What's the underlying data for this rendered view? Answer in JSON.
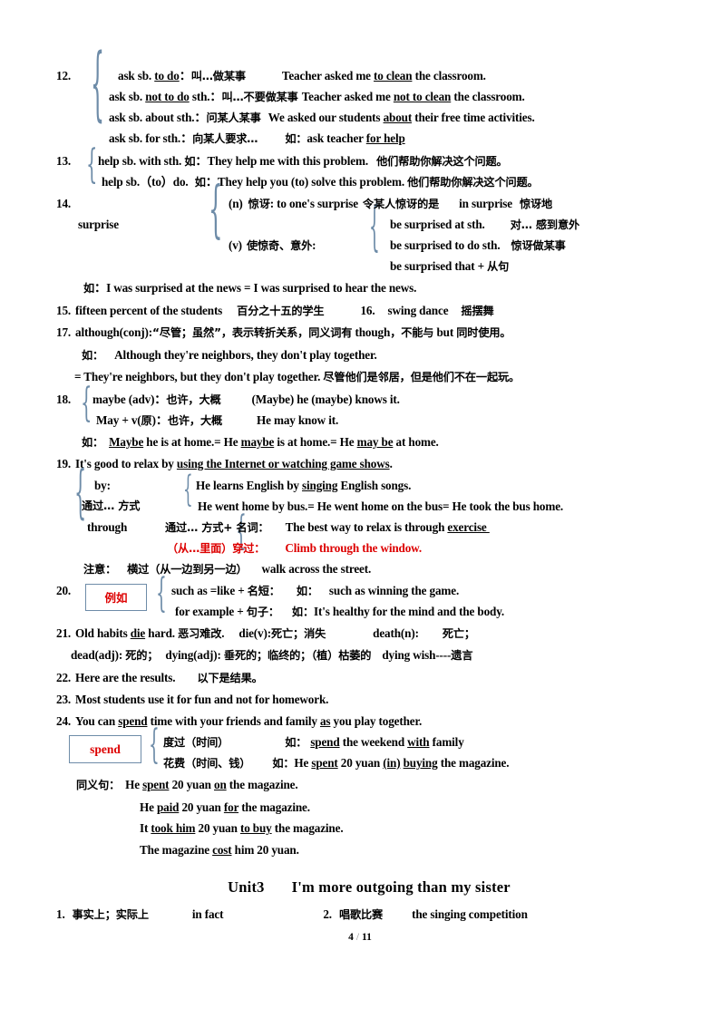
{
  "document": {
    "page_label": "4",
    "page_total": "11",
    "page_separator": "/"
  },
  "colors": {
    "brace": "#6E8CA8",
    "accent_red": "#DD0000",
    "text": "#000000",
    "box_border": "#6E8CA8"
  },
  "entries": [
    {
      "number": "12.",
      "lines": [
        "ask sb. to do：叫…做某事",
        "ask sb. not to do sth.：叫…不要做某事",
        "ask sb. about sth.：问某人某事",
        "ask sb. for sth.：向某人要求…"
      ],
      "examples": [
        "Teacher asked me to clean the classroom.",
        "Teacher asked me not to clean the classroom.",
        "We asked our students about their free time activities.",
        "如：ask teacher for help"
      ]
    },
    {
      "number": "13.",
      "lines": [
        "help sb. with sth.  如：They help me with this problem.  他们帮助你解决这个问题。",
        "help sb.（to）do.   如：They help you (to) solve this problem. 他们帮助你解决这个问题。"
      ]
    },
    {
      "number": "14.",
      "headword": "surprise",
      "noun_label": "(n) 惊讶:",
      "noun_items": "to one's surprise  令某人惊讶的是",
      "noun_items2": "in surprise   惊讶地",
      "verb_label": "(v) 使惊奇、意外:",
      "verb_items": [
        {
          "en": "be surprised at sth.",
          "cn": "对… 感到意外"
        },
        {
          "en": "be surprised to do sth.",
          "cn": "惊讶做某事"
        },
        {
          "en": "be surprised that + 从句",
          "cn": ""
        }
      ],
      "example": "如：I was surprised at the news = I was surprised to hear the news."
    },
    {
      "number": "15.",
      "text": "fifteen percent of the students",
      "cn": "百分之十五的学生",
      "number2": "16.",
      "text2": "swing dance",
      "cn2": "摇摆舞"
    },
    {
      "number": "17.",
      "definition": "although(conj):“尽管；虽然”，表示转折关系，同义词有 though，不能与 but 同时使用。",
      "example1": "如：   Although they're neighbors, they don't play together.",
      "example2": "= They're neighbors, but they don't play together. 尽管他们是邻居，但是他们不在一起玩。"
    },
    {
      "number": "18.",
      "line1": "maybe (adv)：也许，大概",
      "line1b": "(Maybe) he (maybe) knows it.",
      "line2": "May + v(原)：也许，大概",
      "line2b": "He may know it.",
      "example": "如：Maybe he is at home.= He maybe is at home.= He may be at home."
    },
    {
      "number": "19.",
      "main": "It's good to relax by using the Internet or watching game shows.",
      "by_label": "by:",
      "by_cn": "通过… 方式",
      "through_label": "through",
      "by_ex1": "He learns English by singing English songs.",
      "by_ex2": "He went home by bus.= He went home on the bus= He took the bus home.",
      "through_cn1": "通过… 方式+ 名词：",
      "through_ex1": "The best way to relax is through exercise",
      "through_cn2": "（从…里面）穿过：",
      "through_ex2": "Climb through the window.",
      "note_label": "注意：",
      "note_cn": "横过（从一边到另一边）",
      "note_en": "walk across the street."
    },
    {
      "number": "20.",
      "box_label": "例如",
      "line1": "such as =like + 名短：",
      "line1_ex": "如：   such as winning the game.",
      "line2": "for example + 句子：",
      "line2_ex": "如：It's healthy for the mind and the body."
    },
    {
      "number": "21.",
      "line1": "Old habits die hard. 恶习难改.    die(v):死亡；消失        death(n):      死亡；",
      "line2": "dead(adj): 死的；  dying(adj): 垂死的；临终的；（植）枯萎的   dying wish----遗言"
    },
    {
      "number": "22.",
      "text": "Here are the results.    以下是结果。"
    },
    {
      "number": "23.",
      "text": "Most students use it for fun and not for homework."
    },
    {
      "number": "24.",
      "main": "You can spend time with your friends and family as you play together.",
      "box_label": "spend",
      "sense1_cn": "度过（时间）",
      "sense1_ex": "如：spend the weekend with family",
      "sense2_cn": "花费（时间、钱）",
      "sense2_ex": "如：He spent 20 yuan (in) buying the magazine.",
      "syn_label": "同义句：",
      "syn1": "He spent 20 yuan on the magazine.",
      "syn2": "He paid 20 yuan for the magazine.",
      "syn3": "It took him 20 yuan to buy the magazine.",
      "syn4": "The magazine cost him 20 yuan."
    }
  ],
  "unit_heading": {
    "unit": "Unit3",
    "title": "I'm more outgoing than my sister"
  },
  "unit_items": [
    {
      "number": "1.",
      "cn": "事实上；实际上",
      "en": "in fact"
    },
    {
      "number": "2.",
      "cn": "唱歌比赛",
      "en": "the singing competition"
    }
  ]
}
